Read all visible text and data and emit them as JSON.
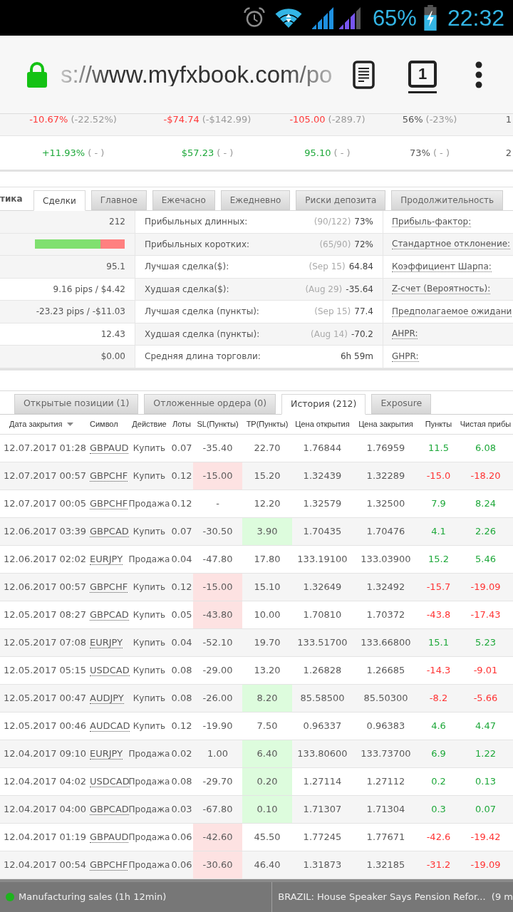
{
  "status_bar": {
    "battery": "65%",
    "time": "22:32"
  },
  "address_bar": {
    "url": "s://www.myfxbook.com/po",
    "tab_count": "1"
  },
  "summary": {
    "rows": [
      {
        "cells": [
          {
            "value": "-10.67%",
            "change": "(-22.52%)",
            "kind": "negative"
          },
          {
            "value": "-$74.74",
            "change": "(-$142.99)",
            "kind": "negative"
          },
          {
            "value": "-105.00",
            "change": "(-289.7)",
            "kind": "negative"
          },
          {
            "value": "56%",
            "change": "(-23%)",
            "kind": "neutral"
          },
          {
            "value": "1",
            "kind": "neutral"
          }
        ]
      },
      {
        "cells": [
          {
            "value": "+11.93%",
            "change": "( - )",
            "kind": "positive"
          },
          {
            "value": "$57.23",
            "change": "( - )",
            "kind": "positive"
          },
          {
            "value": "95.10",
            "change": "( - )",
            "kind": "positive"
          },
          {
            "value": "73%",
            "change": "( - )",
            "kind": "neutral"
          },
          {
            "value": "2",
            "kind": "neutral"
          }
        ]
      }
    ]
  },
  "stats": {
    "section_title": "тика",
    "tabs": [
      {
        "label": "Сделки",
        "selected": true
      },
      {
        "label": "Главное",
        "selected": false
      },
      {
        "label": "Ежечасно",
        "selected": false
      },
      {
        "label": "Ежедневно",
        "selected": false
      },
      {
        "label": "Риски депозита",
        "selected": false
      },
      {
        "label": "Продолжительность",
        "selected": false
      }
    ],
    "rows": [
      {
        "col_1": {
          "kind": "text",
          "text": "212"
        },
        "label": "Прибыльных длинных:",
        "detail": "(90/122)",
        "value": "73%",
        "side_label": "Прибыль-фактор:"
      },
      {
        "col_1": {
          "kind": "bar",
          "level": 0.73
        },
        "label": "Прибыльных коротких:",
        "detail": "(65/90)",
        "value": "72%",
        "side_label": "Стандартное отклонение:"
      },
      {
        "col_1": {
          "kind": "text",
          "text": "95.1"
        },
        "label": "Лучшая сделка($):",
        "detail": "(Sep 15)",
        "value": "64.84",
        "side_label": "Коэффициент Шарпа:"
      },
      {
        "col_1": {
          "kind": "text",
          "text": "9.16 pips / $4.42"
        },
        "label": "Худшая сделка($):",
        "detail": "(Aug 29)",
        "value": "-35.64",
        "side_label": "Z-счет (Вероятность):"
      },
      {
        "col_1": {
          "kind": "text",
          "text": "-23.23 pips / -$11.03"
        },
        "label": "Лучшая сделка (пункты):",
        "detail": "(Sep 15)",
        "value": "77.4",
        "side_label": "Предполагаемое ожидани"
      },
      {
        "col_1": {
          "kind": "text",
          "text": "12.43"
        },
        "label": "Худшая сделка (пункты):",
        "detail": "(Aug 14)",
        "value": "-70.2",
        "side_label": "AHPR:"
      },
      {
        "col_1": {
          "kind": "text",
          "text": "$0.00"
        },
        "label": "Средняя длина торговли:",
        "value": "6h 59m",
        "side_label": "GHPR:"
      }
    ]
  },
  "trades": {
    "tabs": [
      {
        "label": "Открытые позиции (1)",
        "selected": false
      },
      {
        "label": "Отложенные ордера (0)",
        "selected": false
      },
      {
        "label": "История (212)",
        "selected": true
      },
      {
        "label": "Exposure",
        "selected": false
      }
    ],
    "columns": [
      {
        "label": "Дата закрытия",
        "sorted": true
      },
      {
        "label": "Символ",
        "sorted": false
      },
      {
        "label": "Действие",
        "sorted": false
      },
      {
        "label": "Лоты",
        "sorted": false
      },
      {
        "label": "SL(Пункты)",
        "sorted": false
      },
      {
        "label": "TP(Пункты)",
        "sorted": false
      },
      {
        "label": "Цена открытия",
        "sorted": false
      },
      {
        "label": "Цена закрытия",
        "sorted": false
      },
      {
        "label": "Пункты",
        "sorted": false
      },
      {
        "label": "Чистая прибы",
        "sorted": false
      }
    ],
    "rows": [
      {
        "closed": "12.07.2017 01:28",
        "symbol": "GBPAUD",
        "action": "Купить",
        "lots": "0.07",
        "sl": "-35.40",
        "tp": "22.70",
        "open": "1.76844",
        "close": "1.76959",
        "pips": "11.5",
        "profit": "6.08",
        "profitable": true,
        "sl_hit": false,
        "tp_hit": false
      },
      {
        "closed": "12.07.2017 00:57",
        "symbol": "GBPCHF",
        "action": "Купить",
        "lots": "0.12",
        "sl": "-15.00",
        "tp": "15.20",
        "open": "1.32439",
        "close": "1.32289",
        "pips": "-15.0",
        "profit": "-18.20",
        "profitable": false,
        "sl_hit": true,
        "tp_hit": false
      },
      {
        "closed": "12.07.2017 00:05",
        "symbol": "GBPCHF",
        "action": "Продажа",
        "lots": "0.12",
        "sl": "-",
        "tp": "12.20",
        "open": "1.32579",
        "close": "1.32500",
        "pips": "7.9",
        "profit": "8.24",
        "profitable": true,
        "sl_hit": false,
        "tp_hit": false
      },
      {
        "closed": "12.06.2017 03:39",
        "symbol": "GBPCAD",
        "action": "Купить",
        "lots": "0.07",
        "sl": "-30.50",
        "tp": "3.90",
        "open": "1.70435",
        "close": "1.70476",
        "pips": "4.1",
        "profit": "2.26",
        "profitable": true,
        "sl_hit": false,
        "tp_hit": true
      },
      {
        "closed": "12.06.2017 02:02",
        "symbol": "EURJPY",
        "action": "Продажа",
        "lots": "0.04",
        "sl": "-47.80",
        "tp": "17.80",
        "open": "133.19100",
        "close": "133.03900",
        "pips": "15.2",
        "profit": "5.46",
        "profitable": true,
        "sl_hit": false,
        "tp_hit": false
      },
      {
        "closed": "12.06.2017 00:57",
        "symbol": "GBPCHF",
        "action": "Купить",
        "lots": "0.12",
        "sl": "-15.00",
        "tp": "15.10",
        "open": "1.32649",
        "close": "1.32492",
        "pips": "-15.7",
        "profit": "-19.09",
        "profitable": false,
        "sl_hit": true,
        "tp_hit": false
      },
      {
        "closed": "12.05.2017 08:27",
        "symbol": "GBPCAD",
        "action": "Купить",
        "lots": "0.05",
        "sl": "-43.80",
        "tp": "10.00",
        "open": "1.70810",
        "close": "1.70372",
        "pips": "-43.8",
        "profit": "-17.43",
        "profitable": false,
        "sl_hit": true,
        "tp_hit": false
      },
      {
        "closed": "12.05.2017 07:08",
        "symbol": "EURJPY",
        "action": "Купить",
        "lots": "0.04",
        "sl": "-52.10",
        "tp": "19.70",
        "open": "133.51700",
        "close": "133.66800",
        "pips": "15.1",
        "profit": "5.23",
        "profitable": true,
        "sl_hit": false,
        "tp_hit": false
      },
      {
        "closed": "12.05.2017 05:15",
        "symbol": "USDCAD",
        "action": "Купить",
        "lots": "0.08",
        "sl": "-29.00",
        "tp": "13.20",
        "open": "1.26828",
        "close": "1.26685",
        "pips": "-14.3",
        "profit": "-9.01",
        "profitable": false,
        "sl_hit": false,
        "tp_hit": false
      },
      {
        "closed": "12.05.2017 00:47",
        "symbol": "AUDJPY",
        "action": "Купить",
        "lots": "0.08",
        "sl": "-26.00",
        "tp": "8.20",
        "open": "85.58500",
        "close": "85.50300",
        "pips": "-8.2",
        "profit": "-5.66",
        "profitable": false,
        "sl_hit": false,
        "tp_hit": true
      },
      {
        "closed": "12.05.2017 00:46",
        "symbol": "AUDCAD",
        "action": "Купить",
        "lots": "0.12",
        "sl": "-19.90",
        "tp": "7.50",
        "open": "0.96337",
        "close": "0.96383",
        "pips": "4.6",
        "profit": "4.47",
        "profitable": true,
        "sl_hit": false,
        "tp_hit": false
      },
      {
        "closed": "12.04.2017 09:10",
        "symbol": "EURJPY",
        "action": "Продажа",
        "lots": "0.02",
        "sl": "1.00",
        "tp": "6.40",
        "open": "133.80600",
        "close": "133.73700",
        "pips": "6.9",
        "profit": "1.22",
        "profitable": true,
        "sl_hit": false,
        "tp_hit": true
      },
      {
        "closed": "12.04.2017 04:02",
        "symbol": "USDCAD",
        "action": "Продажа",
        "lots": "0.08",
        "sl": "-29.70",
        "tp": "0.20",
        "open": "1.27114",
        "close": "1.27112",
        "pips": "0.2",
        "profit": "0.13",
        "profitable": true,
        "sl_hit": false,
        "tp_hit": true
      },
      {
        "closed": "12.04.2017 04:00",
        "symbol": "GBPCAD",
        "action": "Продажа",
        "lots": "0.03",
        "sl": "-67.80",
        "tp": "0.10",
        "open": "1.71307",
        "close": "1.71304",
        "pips": "0.3",
        "profit": "0.07",
        "profitable": true,
        "sl_hit": false,
        "tp_hit": true
      },
      {
        "closed": "12.04.2017 01:19",
        "symbol": "GBPAUD",
        "action": "Продажа",
        "lots": "0.06",
        "sl": "-42.60",
        "tp": "45.50",
        "open": "1.77245",
        "close": "1.77671",
        "pips": "-42.6",
        "profit": "-19.42",
        "profitable": false,
        "sl_hit": true,
        "tp_hit": false
      },
      {
        "closed": "12.04.2017 00:54",
        "symbol": "GBPCHF",
        "action": "Продажа",
        "lots": "0.06",
        "sl": "-30.60",
        "tp": "46.40",
        "open": "1.31873",
        "close": "1.32185",
        "pips": "-31.2",
        "profit": "-19.09",
        "profitable": false,
        "sl_hit": true,
        "tp_hit": false
      }
    ]
  },
  "ticker": {
    "items": [
      {
        "text": "Manufacturing sales (1h 12min)",
        "color": "#1db41d"
      },
      {
        "text": "BRAZIL: House Speaker Says Pension Refor...  (9 m"
      }
    ]
  }
}
